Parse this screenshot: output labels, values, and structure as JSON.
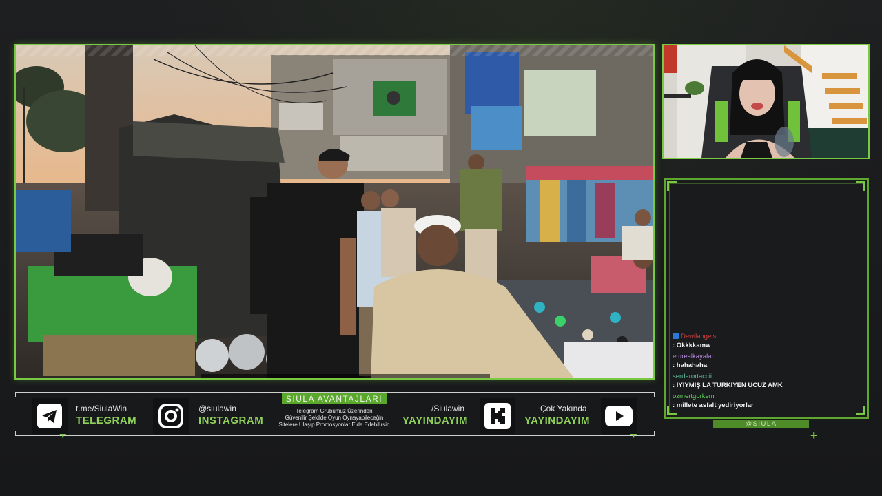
{
  "stream": {
    "handle_tag": "@SIULA"
  },
  "chat": {
    "messages": [
      {
        "user": "Dewilangels",
        "text": ": Ökkkkamw",
        "user_color": "#d64040",
        "badge": true
      },
      {
        "user": "emrealkayalar",
        "text": ": hahahaha",
        "user_color": "#b98be0",
        "badge": false
      },
      {
        "user": "serdarortaccii",
        "text": ": İYİYMİŞ LA TÜRKİYEN UCUZ AMK",
        "user_color": "#5fbf9a",
        "badge": false
      },
      {
        "user": "ozmertgorkem",
        "text": ": millete asfalt yediriyorlar",
        "user_color": "#5fd15a",
        "badge": false
      }
    ]
  },
  "social_bar": {
    "telegram": {
      "line": "t.me/SiulaWin",
      "name": "TELEGRAM",
      "icon": "telegram-icon"
    },
    "instagram": {
      "line": "@siulawin",
      "name": "INSTAGRAM",
      "icon": "instagram-icon"
    },
    "promo": {
      "title": "SIULA AVANTAJLARI",
      "line1": "Telegram Grubumuz Üzerinden",
      "line2": "Güvenilir Şekilde Oyun Oynayabileceğin",
      "line3": "Sitelere Ulaşıp Promosyonlar Elde Edebilirsin"
    },
    "kick": {
      "line": "/Siulawin",
      "name": "YAYINDAYIM",
      "icon": "kick-icon"
    },
    "youtube": {
      "line": "Çok Yakında",
      "name": "YAYINDAYIM",
      "icon": "youtube-icon"
    }
  },
  "colors": {
    "accent": "#7ac943",
    "background": "#1b1c1e"
  }
}
